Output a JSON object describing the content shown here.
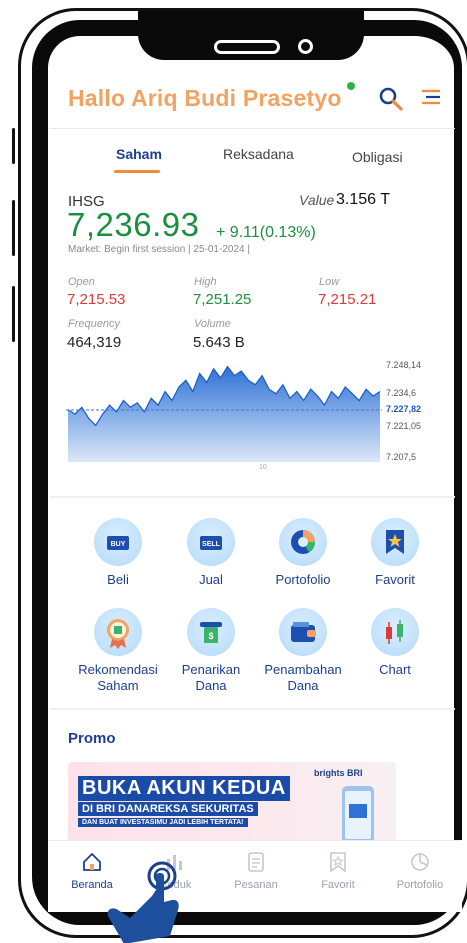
{
  "header": {
    "greeting": "Hallo Ariq Budi Prasetyo"
  },
  "tabs": [
    {
      "label": "Saham",
      "active": true
    },
    {
      "label": "Reksadana",
      "active": false
    },
    {
      "label": "Obligasi",
      "active": false
    }
  ],
  "market": {
    "index_name": "IHSG",
    "value_label": "Value",
    "value_amount": "3.156 T",
    "price": "7,236.93",
    "change": "+ 9.11(0.13%)",
    "status": "Market: Begin first session | 25-01-2024 |"
  },
  "stats": {
    "open_label": "Open",
    "open_value": "7,215.53",
    "high_label": "High",
    "high_value": "7,251.25",
    "low_label": "Low",
    "low_value": "7,215.21",
    "frequency_label": "Frequency",
    "frequency_value": "464,319",
    "volume_label": "Volume",
    "volume_value": "5.643 B"
  },
  "chart_data": {
    "type": "area",
    "y_ticks": [
      "7.248,14",
      "7.234,6",
      "7.227,82",
      "7.221,05",
      "7.207,5"
    ],
    "reference_line": "7.227,82",
    "x_ticks": [
      "10"
    ],
    "ylim": [
      7207.5,
      7248.14
    ],
    "values": [
      7228,
      7226,
      7229,
      7224,
      7221,
      7226,
      7230,
      7227,
      7232,
      7229,
      7231,
      7227,
      7233,
      7230,
      7236,
      7232,
      7238,
      7241,
      7236,
      7244,
      7240,
      7246,
      7242,
      7247,
      7243,
      7245,
      7241,
      7239,
      7243,
      7237,
      7235,
      7239,
      7233,
      7236,
      7232,
      7237,
      7234,
      7230,
      7236,
      7233,
      7238,
      7235,
      7232,
      7237,
      7234,
      7236
    ],
    "colors": {
      "line": "#1a5bc4",
      "fill_top": "#2f72d6",
      "fill_bottom": "#dbe8f8",
      "reference": "#2c7be5"
    }
  },
  "menu": [
    {
      "label": "Beli",
      "icon": "buy-icon"
    },
    {
      "label": "Jual",
      "icon": "sell-icon"
    },
    {
      "label": "Portofolio",
      "icon": "pie-chart-icon"
    },
    {
      "label": "Favorit",
      "icon": "bookmark-star-icon"
    },
    {
      "label": "Rekomendasi\nSaham",
      "icon": "recommendation-badge-icon"
    },
    {
      "label": "Penarikan\nDana",
      "icon": "withdraw-icon"
    },
    {
      "label": "Penambahan\nDana",
      "icon": "wallet-icon"
    },
    {
      "label": "Chart",
      "icon": "candlestick-icon"
    }
  ],
  "promo": {
    "title": "Promo",
    "banner_line1": "BUKA AKUN KEDUA",
    "banner_line2": "DI BRI DANAREKSA SEKURITAS",
    "banner_line3": "DAN BUAT INVESTASIMU JADI LEBIH TERTATA!",
    "brand": "brights BRI"
  },
  "bottom_nav": [
    {
      "label": "Beranda",
      "icon": "home-icon",
      "active": true
    },
    {
      "label": "Produk",
      "icon": "product-icon",
      "active": false
    },
    {
      "label": "Pesanan",
      "icon": "orders-icon",
      "active": false
    },
    {
      "label": "Favorit",
      "icon": "favorite-icon",
      "active": false
    },
    {
      "label": "Portofolio",
      "icon": "portfolio-icon",
      "active": false
    }
  ],
  "colors": {
    "brand_orange": "#f4a261",
    "brand_blue": "#1c3f8f",
    "up_green": "#1c8f3e",
    "down_red": "#d93a3a"
  }
}
